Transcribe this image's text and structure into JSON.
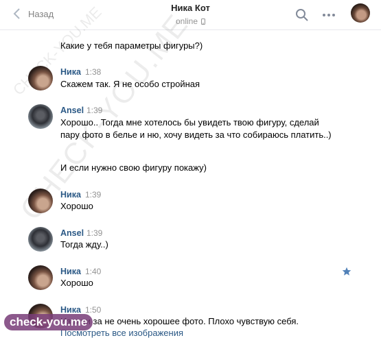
{
  "header": {
    "back_label": "Назад",
    "title": "Ника Кот",
    "status": "online"
  },
  "messages": [
    {
      "text": "Какие у тебя параметры фигуры?)"
    },
    {
      "author": "Ника",
      "time": "1:38",
      "text": "Скажем так. Я не особо стройная"
    },
    {
      "author": "Ansel",
      "time": "1:39",
      "text": "Хорошо.. Тогда мне хотелось бы увидеть твою фигуру, сделай пару фото в белье и ню, хочу видеть за что собираюсь платить..)",
      "text2": "И если нужно свою фигуру покажу)"
    },
    {
      "author": "Ника",
      "time": "1:39",
      "text": "Хорошо"
    },
    {
      "author": "Ansel",
      "time": "1:39",
      "text": "Тогда жду..)"
    },
    {
      "author": "Ника",
      "time": "1:40",
      "text": "Хорошо"
    },
    {
      "author": "Ника",
      "time": "1:50",
      "text": "Извини за не очень хорошее фото. Плохо чувствую себя.",
      "link": "Посмотреть все изображения"
    }
  ],
  "watermarks": {
    "large": "CHECK-YOU.ME",
    "small": "CHECK-YOU.ME",
    "badge": "check-you.me"
  },
  "colors": {
    "name_link": "#2a5885",
    "muted": "#939393",
    "star": "#5181b8"
  },
  "icons": [
    "back-chevron-icon",
    "phone-icon",
    "search-icon",
    "more-icon",
    "star-icon"
  ]
}
